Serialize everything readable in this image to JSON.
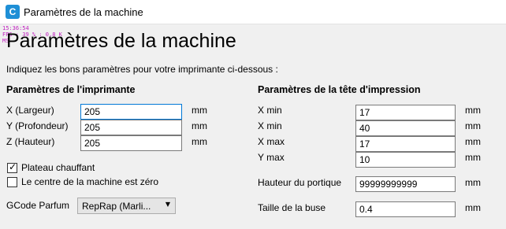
{
  "window": {
    "title": "Paramètres de la machine",
    "app_icon": "cura-logo-icon"
  },
  "debug_overlay": {
    "line1": "15:36:54",
    "line2": "FPS : 39 % : 0.8 K",
    "line3": "MS"
  },
  "page": {
    "heading": "Paramètres de la machine",
    "intro": "Indiquez les bons paramètres pour votre imprimante ci-dessous :"
  },
  "printer": {
    "section_title": "Paramètres de l'imprimante",
    "fields": [
      {
        "label": "X (Largeur)",
        "value": "205",
        "unit": "mm"
      },
      {
        "label": "Y (Profondeur)",
        "value": "205",
        "unit": "mm"
      },
      {
        "label": "Z (Hauteur)",
        "value": "205",
        "unit": "mm"
      }
    ],
    "heated_bed": {
      "label": "Plateau chauffant",
      "checked": true
    },
    "center_zero": {
      "label": "Le centre de la machine est zéro",
      "checked": false
    },
    "gcode_flavor": {
      "label": "GCode Parfum",
      "selected": "RepRap (Marli..."
    }
  },
  "printhead": {
    "section_title": "Paramètres de la tête d'impression",
    "fields": [
      {
        "label": "X min",
        "value": "17",
        "unit": "mm"
      },
      {
        "label": "X min",
        "value": "40",
        "unit": "mm"
      },
      {
        "label": "X max",
        "value": "17",
        "unit": "mm"
      },
      {
        "label": "Y max",
        "value": "10",
        "unit": "mm"
      }
    ],
    "gantry_height": {
      "label": "Hauteur du portique",
      "value": "99999999999",
      "unit": "mm"
    },
    "nozzle_size": {
      "label": "Taille de la buse",
      "value": "0.4",
      "unit": "mm"
    }
  },
  "colors": {
    "accent": "#0078d7",
    "debug": "#c020c0",
    "app_icon": "#1e8fd6"
  }
}
